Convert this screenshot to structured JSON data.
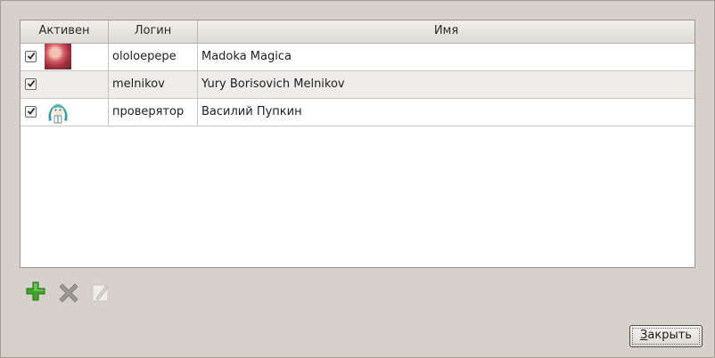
{
  "table": {
    "columns": [
      "Активен",
      "Логин",
      "Имя"
    ],
    "rows": [
      {
        "active": true,
        "avatar": "photo-avatar",
        "login": "ololoepepe",
        "name": "Madoka Magica"
      },
      {
        "active": true,
        "avatar": "",
        "login": "melnikov",
        "name": "Yury Borisovich Melnikov"
      },
      {
        "active": true,
        "avatar": "anime-character-avatar",
        "login": "проверятор",
        "name": "Василий Пупкин"
      }
    ]
  },
  "toolbar": {
    "add_icon": "plus-icon",
    "remove_icon": "delete-x-icon",
    "edit_icon": "edit-page-icon",
    "colors": {
      "add": "#3fa52b",
      "remove": "#9a9893",
      "edit": "#c9c6c0"
    }
  },
  "close_button": {
    "label": "Закрыть",
    "mnemonic": "З"
  }
}
